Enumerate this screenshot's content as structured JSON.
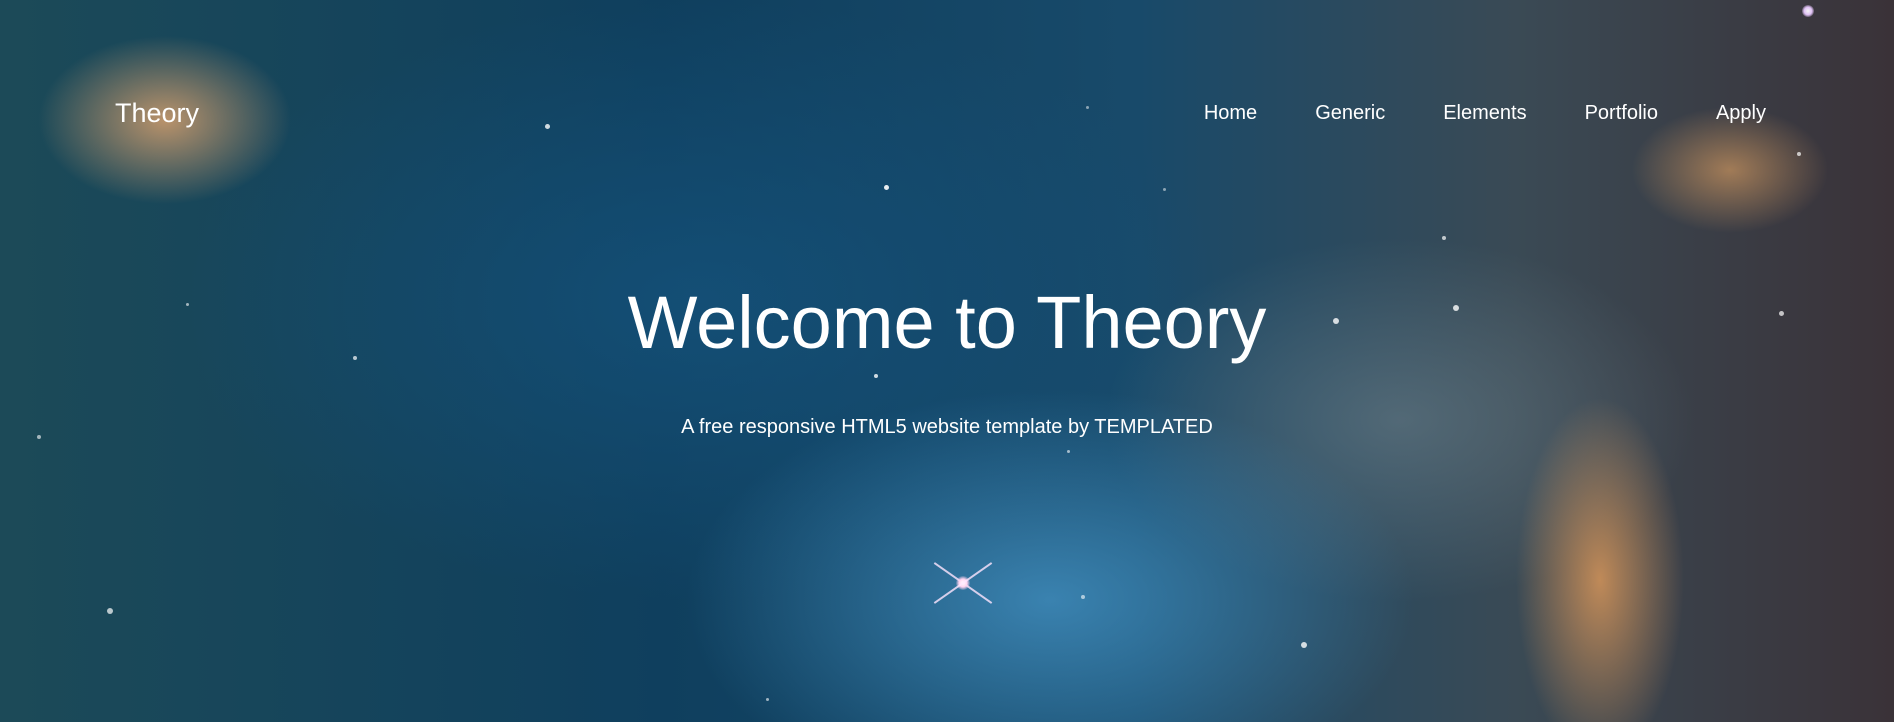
{
  "header": {
    "logo_text": "Theory",
    "nav": [
      {
        "label": "Home"
      },
      {
        "label": "Generic"
      },
      {
        "label": "Elements"
      },
      {
        "label": "Portfolio"
      },
      {
        "label": "Apply"
      }
    ]
  },
  "hero": {
    "title": "Welcome to Theory",
    "subtitle": "A free responsive HTML5 website template by TEMPLATED"
  }
}
